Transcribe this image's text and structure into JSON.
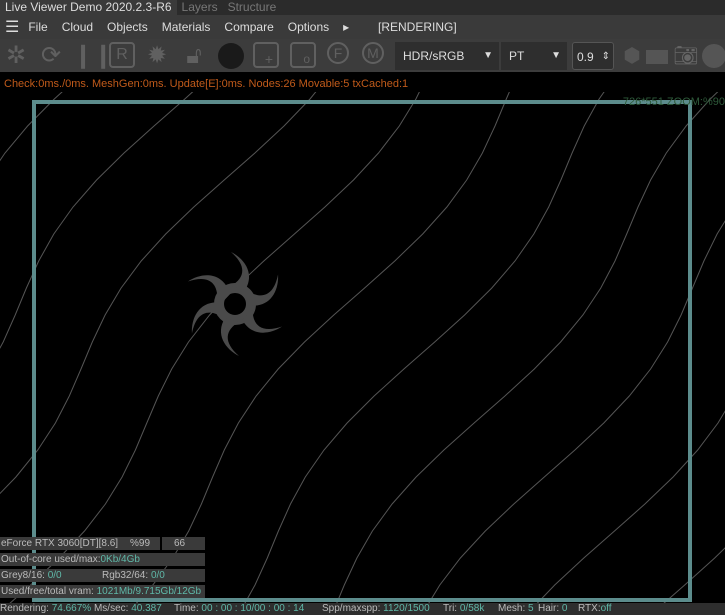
{
  "title": {
    "app": "Live Viewer Demo 2020.2.3-R6",
    "tabs": [
      "Layers",
      "Structure"
    ]
  },
  "menu": {
    "items": [
      "File",
      "Cloud",
      "Objects",
      "Materials",
      "Compare",
      "Options"
    ],
    "more": "▸",
    "state": "[RENDERING]"
  },
  "toolbar": {
    "icons": [
      "octane-logo-icon",
      "refresh-icon",
      "pause-icon",
      "r-icon",
      "gear-icon",
      "lock-icon",
      "sphere-icon",
      "add-region-icon",
      "region-icon",
      "focus-pick-icon",
      "material-pick-icon"
    ],
    "imager": "HDR/sRGB",
    "kernel": "PT",
    "value": "0.9"
  },
  "status_line": "Check:0ms./0ms. MeshGen:0ms. Update[E]:0ms. Nodes:26 Movable:5 txCached:1",
  "zoom_readout": "726*551 ZOOM:%90",
  "overlay": {
    "gpu": "eForce RTX 3060[DT][8.6]",
    "gpu_usage": "%99",
    "gpu_temp": "66",
    "ooc_label": "Out-of-core used/max:",
    "ooc_value": "0Kb/4Gb",
    "grey_label": "Grey8/16: ",
    "grey_value": "0/0",
    "rgb_label": "Rgb32/64: ",
    "rgb_value": "0/0",
    "vram_label": "Used/free/total vram: ",
    "vram_value": "1021Mb/9.715Gb/12Gb"
  },
  "bottom": {
    "rendering_label": "Rendering: ",
    "rendering_value": "74.667%",
    "ms_label": " Ms/sec: ",
    "ms_value": "40.387",
    "time_label": "Time: ",
    "time_value": "00 : 00 : 10/00 : 00 : 14",
    "spp_label": "Spp/maxspp: ",
    "spp_value": "1120/1500",
    "tri_label": "Tri: ",
    "tri_value": "0/58k",
    "mesh_label": "Mesh: ",
    "mesh_value": "5",
    "hair_label": "Hair: ",
    "hair_value": "0",
    "rtx_label": "RTX:",
    "rtx_value": "off"
  },
  "colors": {
    "frame": "#5c8c8c",
    "status": "#c05a1a",
    "value": "#5fb8a8"
  }
}
